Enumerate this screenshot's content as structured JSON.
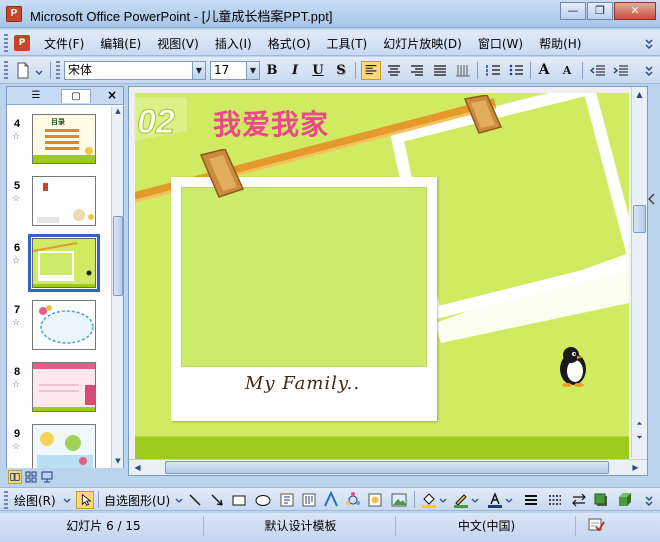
{
  "window": {
    "title": "Microsoft Office PowerPoint - [儿童成长档案PPT.ppt]",
    "app_icon_glyph": "P",
    "btn_minimize": "—",
    "btn_restore": "❐",
    "btn_close": "✕"
  },
  "menu": {
    "items": [
      "文件(F)",
      "编辑(E)",
      "视图(V)",
      "插入(I)",
      "格式(O)",
      "工具(T)",
      "幻灯片放映(D)",
      "窗口(W)",
      "帮助(H)"
    ]
  },
  "toolbar": {
    "font_name": "宋体",
    "font_size": "17",
    "bold": "B",
    "italic": "I",
    "underline": "U",
    "shadow": "S",
    "grow_font": "A",
    "shrink_font": "A"
  },
  "outline_pane": {
    "tab_outline": "☰",
    "tab_slides": "▢",
    "close": "×",
    "star": "☆",
    "slides": [
      {
        "number": "4",
        "label": "目录"
      },
      {
        "number": "5"
      },
      {
        "number": "6",
        "selected": true
      },
      {
        "number": "7"
      },
      {
        "number": "8"
      },
      {
        "number": "9"
      }
    ]
  },
  "slide": {
    "badge_number": "02",
    "title": "我爱我家",
    "caption": "My Family.."
  },
  "drawing_toolbar": {
    "draw_menu": "绘图(R)",
    "autoshapes_menu": "自选图形(U)"
  },
  "status": {
    "slide_position": "幻灯片 6 / 15",
    "design_template": "默认设计模板",
    "language": "中文(中国)"
  },
  "colors": {
    "slide_background": "#d0ea62",
    "title_bar": "#b4cdec",
    "selection_border": "#3165c4"
  }
}
